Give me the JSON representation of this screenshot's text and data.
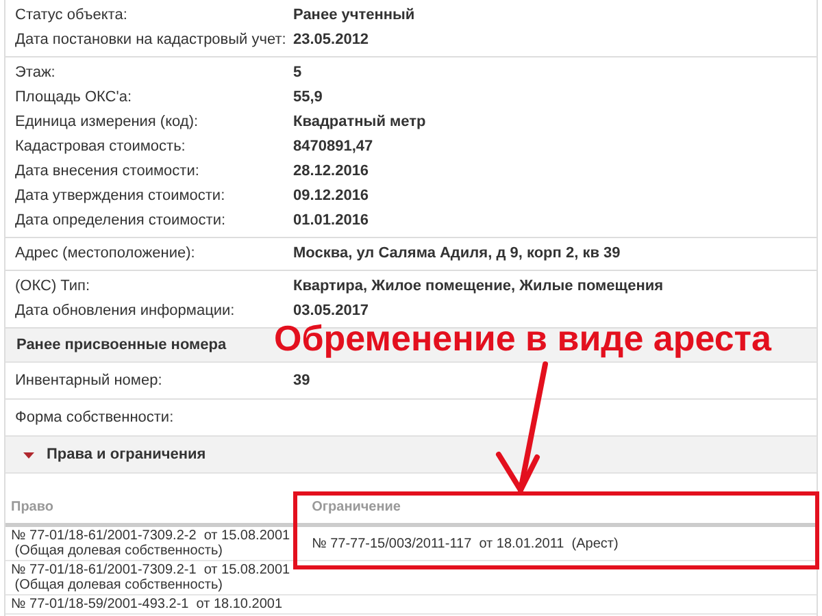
{
  "property_groups": [
    {
      "rows": [
        {
          "label": "Статус объекта:",
          "value": "Ранее учтенный"
        },
        {
          "label": "Дата постановки на кадастровый учет:",
          "value": "23.05.2012"
        }
      ]
    },
    {
      "rows": [
        {
          "label": "Этаж:",
          "value": "5"
        },
        {
          "label": "Площадь ОКС'а:",
          "value": "55,9"
        },
        {
          "label": "Единица измерения (код):",
          "value": "Квадратный метр"
        },
        {
          "label": "Кадастровая стоимость:",
          "value": "8470891,47"
        },
        {
          "label": "Дата внесения стоимости:",
          "value": "28.12.2016"
        },
        {
          "label": "Дата утверждения стоимости:",
          "value": "09.12.2016"
        },
        {
          "label": "Дата определения стоимости:",
          "value": "01.01.2016"
        }
      ]
    },
    {
      "rows": [
        {
          "label": "Адрес (местоположение):",
          "value": "Москва, ул Саляма Адиля, д 9, корп 2, кв 39"
        }
      ]
    },
    {
      "rows": [
        {
          "label": "(ОКС) Тип:",
          "value": "Квартира, Жилое помещение, Жилые помещения"
        },
        {
          "label": "Дата обновления информации:",
          "value": "03.05.2017"
        }
      ]
    }
  ],
  "previous_numbers": {
    "title": "Ранее присвоенные номера",
    "rows": [
      {
        "label": "Инвентарный номер:",
        "value": "39"
      },
      {
        "label": "Форма собственности:"
      }
    ]
  },
  "rights_section": {
    "title": "Права и ограничения",
    "expanded": true,
    "table": {
      "columns": [
        "Право",
        "Ограничение"
      ],
      "rows": [
        {
          "right": [
            "№ 77-01/18-61/2001-7309.2-2  от 15.08.2001",
            " (Общая долевая собственность)"
          ],
          "restriction": "№ 77-77-15/003/2011-117  от 18.01.2011  (Арест)"
        },
        {
          "right": [
            "№ 77-01/18-61/2001-7309.2-1  от 15.08.2001",
            " (Общая долевая собственность)"
          ]
        },
        {
          "right": [
            "№ 77-01/18-59/2001-493.2-1  от 18.10.2001"
          ]
        }
      ]
    }
  },
  "annotation": {
    "text": "Обременение в виде ареста"
  }
}
